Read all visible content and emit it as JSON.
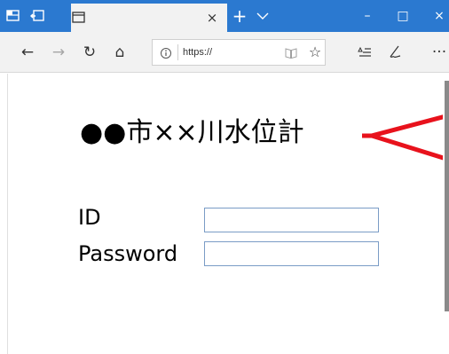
{
  "browser": {
    "tab": {
      "title": "",
      "close_glyph": "×"
    },
    "new_tab_glyph": "+",
    "window_controls": {
      "minimize": "–",
      "maximize": "□",
      "close": "×"
    },
    "nav": {
      "back": "←",
      "forward": "→",
      "refresh": "↻",
      "home": "⌂"
    },
    "address": {
      "value": "https://"
    },
    "favorites_glyph": "☆",
    "favorites_bar_glyph": "☆",
    "more_glyph": "···"
  },
  "page": {
    "title": "●●市××川水位計",
    "fields": [
      {
        "label": "ID",
        "value": ""
      },
      {
        "label": "Password",
        "value": ""
      }
    ]
  },
  "annotation": {
    "arrow_color": "#e8121c"
  },
  "colors": {
    "tabbar": "#2b79d0",
    "field_border": "#7a9cc6"
  }
}
